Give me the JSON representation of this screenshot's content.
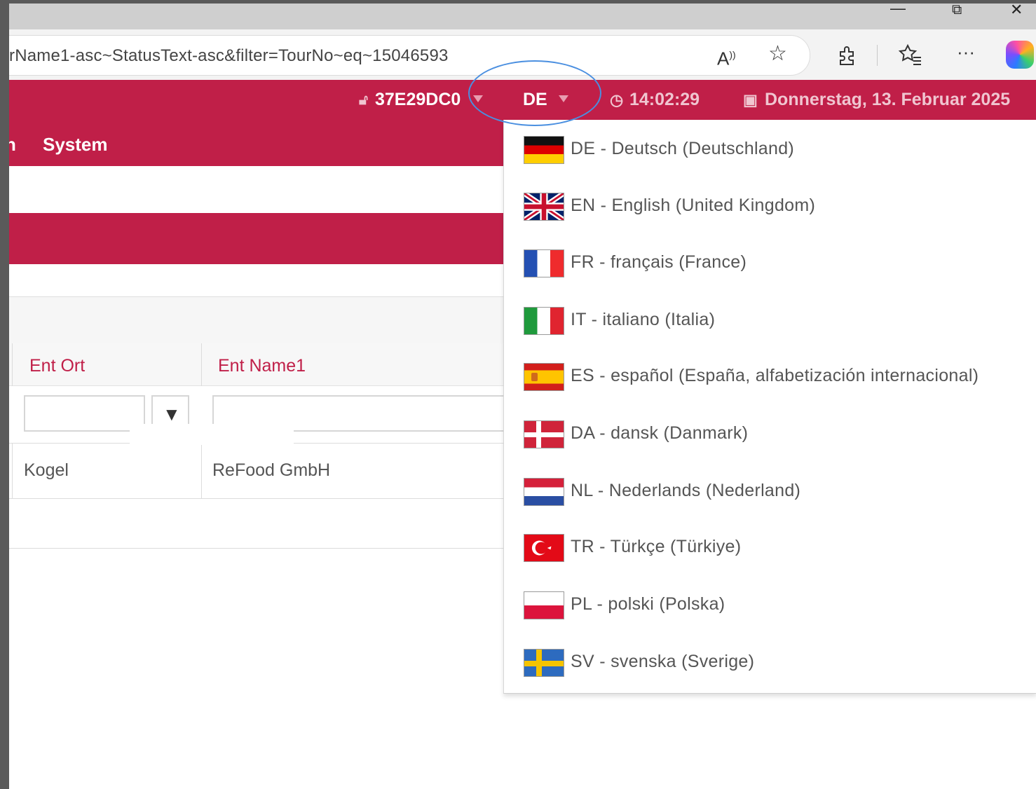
{
  "browser": {
    "url": "rName1-asc~StatusText-asc&filter=TourNo~eq~15046593",
    "window_controls": {
      "minimize": "—",
      "restore": "⧉",
      "close": "✕"
    }
  },
  "header": {
    "session_id": "37E29DC0",
    "language": "DE",
    "time": "14:02:29",
    "date": "Donnerstag, 13. Februar 2025"
  },
  "nav": {
    "items": [
      "n",
      "System"
    ]
  },
  "grid": {
    "columns": [
      "Ent Ort",
      "Ent Name1"
    ],
    "rows": [
      [
        "Kogel",
        "ReFood GmbH"
      ]
    ]
  },
  "language_menu": {
    "items": [
      {
        "code": "DE",
        "label": "DE - Deutsch (Deutschland)",
        "flag": "de"
      },
      {
        "code": "EN",
        "label": "EN - English (United Kingdom)",
        "flag": "gb"
      },
      {
        "code": "FR",
        "label": "FR - français (France)",
        "flag": "fr"
      },
      {
        "code": "IT",
        "label": "IT - italiano (Italia)",
        "flag": "it"
      },
      {
        "code": "ES",
        "label": "ES - español (España, alfabetización internacional)",
        "flag": "es"
      },
      {
        "code": "DA",
        "label": "DA - dansk (Danmark)",
        "flag": "dk"
      },
      {
        "code": "NL",
        "label": "NL - Nederlands (Nederland)",
        "flag": "nl"
      },
      {
        "code": "TR",
        "label": "TR - Türkçe (Türkiye)",
        "flag": "tr"
      },
      {
        "code": "PL",
        "label": "PL - polski (Polska)",
        "flag": "pl"
      },
      {
        "code": "SV",
        "label": "SV - svenska (Sverige)",
        "flag": "se"
      }
    ]
  },
  "colors": {
    "brand": "#c01f48",
    "highlight_ring": "#4a8fe0"
  }
}
